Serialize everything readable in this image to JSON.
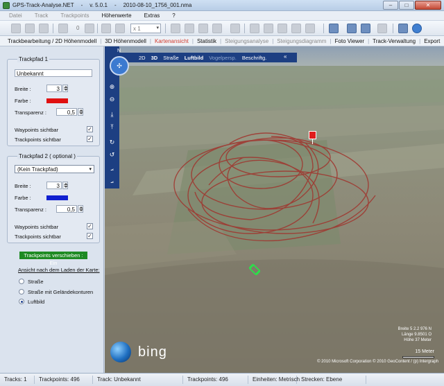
{
  "window": {
    "app_name": "GPS-Track-Analyse.NET",
    "version": "v. 5.0.1",
    "file": "2010-08-10_1756_001.nma",
    "sep": "-"
  },
  "menu": [
    "Datei",
    "Track",
    "Trackpoints",
    "Höhenwerte",
    "Extras",
    "?"
  ],
  "toolbar": {
    "counter": "0",
    "zoom_value": "x 1"
  },
  "tabs": [
    {
      "label": "Trackbearbeitung / 2D Höhenmodell",
      "state": "normal"
    },
    {
      "label": "3D Höhenmodell",
      "state": "normal"
    },
    {
      "label": "Kartenansicht",
      "state": "active"
    },
    {
      "label": "Statistik",
      "state": "normal"
    },
    {
      "label": "Steigungsanalyse",
      "state": "disabled"
    },
    {
      "label": "Steigungsdiagramm",
      "state": "disabled"
    },
    {
      "label": "Foto Viewer",
      "state": "normal"
    },
    {
      "label": "Track-Verwaltung",
      "state": "normal"
    },
    {
      "label": "Export",
      "state": "normal"
    }
  ],
  "track1": {
    "title": "Trackpfad 1",
    "name": "Unbekannt",
    "breite_label": "Breite :",
    "breite_value": "3",
    "farbe_label": "Farbe :",
    "farbe_color": "#e01010",
    "transparenz_label": "Transparenz :",
    "transparenz_value": "0,5",
    "waypoints_label": "Waypoints sichtbar",
    "trackpoints_label": "Trackpoints sichtbar"
  },
  "track2": {
    "title": "Trackpfad 2 ( optional )",
    "select_value": "(Kein Trackpfad)",
    "breite_label": "Breite :",
    "breite_value": "3",
    "farbe_label": "Farbe :",
    "farbe_color": "#1020d0",
    "transparenz_label": "Transparenz :",
    "transparenz_value": "0,5",
    "waypoints_label": "Waypoints sichtbar",
    "trackpoints_label": "Trackpoints sichtbar"
  },
  "trackpoints_status": "Trackpoints verschieben : Ein",
  "view_after_load": {
    "label": "Ansicht nach dem Laden der Karte:",
    "options": [
      "Straße",
      "Straße mit Geländekonturen",
      "Luftbild"
    ],
    "selected": "Luftbild"
  },
  "map_nav": {
    "items": [
      "2D",
      "3D",
      "Straße",
      "Luftbild",
      "Vogelpersp.",
      "Beschriftg."
    ],
    "collapse": "«",
    "compass_n": "N"
  },
  "map": {
    "brand": "bing",
    "coord_line1": "Breite 5 2.2 976 N",
    "coord_line2": "Länge 9.8501 O",
    "coord_line3": "Höhe 37 Meter",
    "scale_label": "15 Meter",
    "copyright": "© 2010 Microsoft Corporation  © 2010 GeoContent / (p) Intergraph"
  },
  "statusbar": {
    "tracks": "Tracks: 1",
    "trackpoints1": "Trackpoints: 496",
    "track": "Track: Unbekannt",
    "trackpoints2": "Trackpoints: 496",
    "einheiten": "Einheiten: Metrisch",
    "strecken": "Strecken: Ebene"
  },
  "icons": [
    "app-icon",
    "open-icon",
    "save-icon",
    "print-icon",
    "refresh-icon",
    "zoom-in-icon",
    "zoom-out-icon",
    "help-icon",
    "compass-icon",
    "globe-icon"
  ]
}
